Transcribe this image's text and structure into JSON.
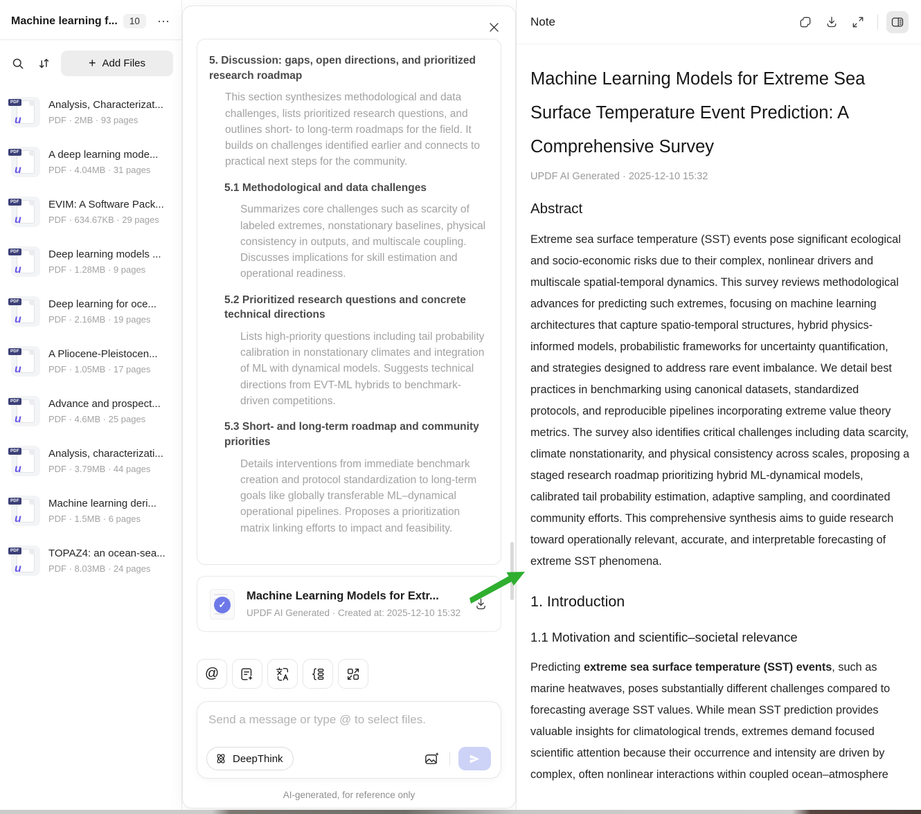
{
  "sidebar": {
    "title": "Machine learning f...",
    "badge": "10",
    "more_icon": "⋯",
    "add_files": {
      "plus": "+",
      "label": "Add Files"
    },
    "icons": [
      "search-icon",
      "sort-icon"
    ],
    "files": [
      {
        "name": "Analysis, Characterizat...",
        "meta": "PDF · 2MB · 93 pages"
      },
      {
        "name": "A deep learning mode...",
        "meta": "PDF · 4.04MB · 31 pages"
      },
      {
        "name": "EVIM: A Software Pack...",
        "meta": "PDF · 634.67KB · 29 pages"
      },
      {
        "name": "Deep learning models ...",
        "meta": "PDF · 1.28MB · 9 pages"
      },
      {
        "name": "Deep learning for oce...",
        "meta": "PDF · 2.16MB · 19 pages"
      },
      {
        "name": "A Pliocene-Pleistocen...",
        "meta": "PDF · 1.05MB · 17 pages"
      },
      {
        "name": "Advance and prospect...",
        "meta": "PDF · 4.6MB · 25 pages"
      },
      {
        "name": "Analysis, characterizati...",
        "meta": "PDF · 3.79MB · 44 pages"
      },
      {
        "name": "Machine learning deri...",
        "meta": "PDF · 1.5MB · 6 pages"
      },
      {
        "name": "TOPAZ4: an ocean-sea...",
        "meta": "PDF · 8.03MB · 24 pages"
      }
    ],
    "file_badge_text": "PDF",
    "file_logo_glyph": "u"
  },
  "chat": {
    "outline": [
      {
        "heading": "5. Discussion: gaps, open directions, and prioritized research roadmap",
        "body": "This section synthesizes methodological and data challenges, lists prioritized research questions, and outlines short- to long-term roadmaps for the field. It builds on challenges identified earlier and connects to practical next steps for the community."
      },
      {
        "heading": "5.1 Methodological and data challenges",
        "body": "Summarizes core challenges such as scarcity of labeled extremes, nonstationary baselines, physical consistency in outputs, and multiscale coupling. Discusses implications for skill estimation and operational readiness."
      },
      {
        "heading": "5.2 Prioritized research questions and concrete technical directions",
        "body": "Lists high-priority questions including tail probability calibration in nonstationary climates and integration of ML with dynamical models. Suggests technical directions from EVT-ML hybrids to benchmark-driven competitions."
      },
      {
        "heading": "5.3 Short- and long-term roadmap and community priorities",
        "body": "Details interventions from immediate benchmark creation and protocol standardization to long-term goals like globally transferable ML–dynamical operational pipelines. Proposes a prioritization matrix linking efforts to impact and feasibility."
      }
    ],
    "result_card": {
      "title": "Machine Learning Models for Extr...",
      "meta": "UPDF AI Generated · Created at: 2025-12-10 15:32",
      "check_glyph": "✓"
    },
    "chip_icons": [
      "mention-icon",
      "note-sparkle-icon",
      "translate-icon",
      "mindmap-icon",
      "convert-icon"
    ],
    "mention_glyph": "@",
    "input_placeholder": "Send a message or type @ to select files.",
    "deepthink_label": "DeepThink",
    "disclaimer": "AI-generated, for reference only"
  },
  "note": {
    "header_title": "Note",
    "header_icons": [
      "copy-icon",
      "download-icon",
      "expand-icon",
      "panel-toggle-icon"
    ],
    "title": "Machine Learning Models for Extreme Sea Surface Temperature Event Prediction: A Comprehensive Survey",
    "byline": "UPDF AI Generated · 2025-12-10 15:32",
    "abstract_heading": "Abstract",
    "abstract_body": "Extreme sea surface temperature (SST) events pose significant ecological and socio-economic risks due to their complex, nonlinear drivers and multiscale spatial-temporal dynamics. This survey reviews methodological advances for predicting such extremes, focusing on machine learning architectures that capture spatio-temporal structures, hybrid physics-informed models, probabilistic frameworks for uncertainty quantification, and strategies designed to address rare event imbalance. We detail best practices in benchmarking using canonical datasets, standardized protocols, and reproducible pipelines incorporating extreme value theory metrics. The survey also identifies critical challenges including data scarcity, climate nonstationarity, and physical consistency across scales, proposing a staged research roadmap prioritizing hybrid ML-dynamical models, calibrated tail probability estimation, adaptive sampling, and coordinated community efforts. This comprehensive synthesis aims to guide research toward operationally relevant, accurate, and interpretable forecasting of extreme SST phenomena.",
    "intro_heading": "1. Introduction",
    "intro_subheading": "1.1 Motivation and scientific–societal relevance",
    "intro_prefix": "Predicting ",
    "intro_bold": "extreme sea surface temperature (SST) events",
    "intro_suffix": ", such as marine heatwaves, poses substantially different challenges compared to forecasting average SST values. While mean SST prediction provides valuable insights for climatological trends, extremes demand focused scientific attention because their occurrence and intensity are driven by complex, often nonlinear interactions within coupled ocean–atmosphere"
  },
  "colors": {
    "accent_purple": "#6e79e8",
    "send_button": "#cdd3f7",
    "annotation_green": "#2fae2f",
    "pdf_badge_navy": "#3b3f77"
  }
}
